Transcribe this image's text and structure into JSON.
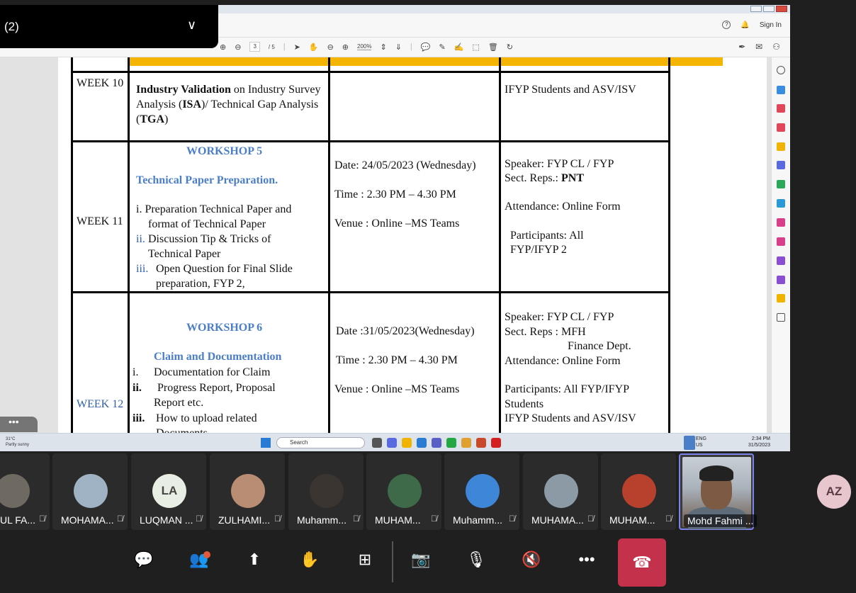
{
  "overlay": {
    "title": "(2)"
  },
  "app": {
    "sign_in": "Sign In",
    "page_current": "3",
    "page_total": "/ 5",
    "zoom": "200%"
  },
  "table": {
    "week10": {
      "label": "WEEK 10",
      "desc_bold1": "Industry Validation",
      "desc_text1": " on Industry Survey Analysis (",
      "desc_bold2": "ISA",
      "desc_text2": ")/ Technical Gap Analysis (",
      "desc_bold3": "TGA",
      "desc_text3": ")",
      "remarks": "IFYP Students and ASV/ISV"
    },
    "week11": {
      "label": "WEEK 11",
      "workshop": "WORKSHOP 5",
      "topic": "Technical Paper Preparation.",
      "items": [
        "i. Preparation Technical Paper and",
        "format of Technical Paper",
        "ii.",
        "Discussion Tip & Tricks of",
        "Technical Paper",
        "iii.",
        "Open Question for Final Slide",
        "preparation, FYP 2,"
      ],
      "date": "Date: 24/05/2023 (Wednesday)",
      "time": "Time :  2.30 PM – 4.30 PM",
      "venue": "Venue : Online –MS Teams",
      "speaker": "Speaker: FYP CL / FYP",
      "sect_prefix": "Sect. Reps.: ",
      "sect_bold": "PNT",
      "attendance": "Attendance: Online Form",
      "participants1": "Participants: All",
      "participants2": "FYP/IFYP  2"
    },
    "week12": {
      "label": "WEEK 12",
      "workshop": "WORKSHOP 6",
      "topic": "Claim and Documentation",
      "items": [
        "i.",
        "Documentation for Claim",
        "ii.",
        "Progress Report, Proposal",
        "Report etc.",
        "iii.",
        "How to upload related",
        "Documents"
      ],
      "date": "Date :31/05/2023(Wednesday)",
      "time": "Time :  2.30 PM – 4.30 PM",
      "venue": "Venue : Online –MS Teams",
      "speaker": "Speaker: FYP CL / FYP",
      "sect": "Sect. Reps : MFH",
      "dept": "Finance Dept.",
      "attendance": "Attendance: Online Form",
      "participants1": "Participants: All FYP/IFYP",
      "participants2": "Students",
      "remarks": "IFYP Students and ASV/ISV"
    }
  },
  "taskbar": {
    "weather_temp": "31°C",
    "weather_desc": "Partly sunny",
    "search": "Search",
    "lang1": "ENG",
    "lang2": "US",
    "time": "2:34 PM",
    "date": "31/5/2023"
  },
  "participants": [
    {
      "name": "UL FA..."
    },
    {
      "name": "MOHAMA..."
    },
    {
      "name": "LUQMAN ...",
      "initials": "LA"
    },
    {
      "name": "ZULHAMI..."
    },
    {
      "name": "Muhamm..."
    },
    {
      "name": "MUHAM..."
    },
    {
      "name": "Muhamm..."
    },
    {
      "name": "MUHAMA..."
    },
    {
      "name": "MUHAM..."
    },
    {
      "name": "Mohd Fahmi ..."
    }
  ],
  "az": "AZ",
  "colors": {
    "accent": "#7b83eb",
    "hangup": "#c4314b",
    "header_yellow": "#f5b400",
    "workshop_blue": "#4a7ec8"
  }
}
